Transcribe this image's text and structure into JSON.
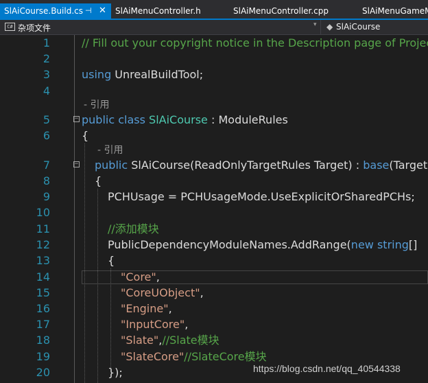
{
  "tabs": [
    {
      "label": "SlAiCourse.Build.cs",
      "active": true
    },
    {
      "label": "SlAiMenuController.h",
      "active": false
    },
    {
      "label": "SlAiMenuController.cpp",
      "active": false
    },
    {
      "label": "SlAiMenuGameM",
      "active": false
    }
  ],
  "tab_pin_glyph": "⊣",
  "tab_close_glyph": "✕",
  "navbar": {
    "project_icon_text": "C#",
    "project_label": "杂项文件",
    "class_label": "SlAiCourse"
  },
  "editor": {
    "refs_label": "引用",
    "lines": [
      {
        "n": "1",
        "tokens": [
          {
            "text": "// Fill out your copyright notice in the Description page of Project",
            "style": "c"
          }
        ]
      },
      {
        "n": "2",
        "tokens": []
      },
      {
        "n": "3",
        "tokens": [
          {
            "text": "using",
            "style": "k"
          },
          {
            "text": " UnrealBuildTool;",
            "style": "p"
          }
        ]
      },
      {
        "n": "4",
        "tokens": []
      },
      {
        "n": "5",
        "tokens": [
          {
            "text": "public",
            "style": "k"
          },
          {
            "text": " ",
            "style": "p"
          },
          {
            "text": "class",
            "style": "k"
          },
          {
            "text": " ",
            "style": "p"
          },
          {
            "text": "SlAiCourse",
            "style": "t"
          },
          {
            "text": " : ModuleRules",
            "style": "p"
          }
        ]
      },
      {
        "n": "6",
        "tokens": [
          {
            "text": "{",
            "style": "p"
          }
        ]
      },
      {
        "n": "7",
        "tokens": [
          {
            "text": "public",
            "style": "k"
          },
          {
            "text": " SlAiCourse(ReadOnlyTargetRules Target) : ",
            "style": "p"
          },
          {
            "text": "base",
            "style": "k"
          },
          {
            "text": "(Target)",
            "style": "p"
          }
        ]
      },
      {
        "n": "8",
        "tokens": [
          {
            "text": "{",
            "style": "p"
          }
        ]
      },
      {
        "n": "9",
        "tokens": [
          {
            "text": "PCHUsage = PCHUsageMode.UseExplicitOrSharedPCHs;",
            "style": "p"
          }
        ]
      },
      {
        "n": "10",
        "tokens": []
      },
      {
        "n": "11",
        "tokens": [
          {
            "text": "//添加模块",
            "style": "c"
          }
        ]
      },
      {
        "n": "12",
        "tokens": [
          {
            "text": "PublicDependencyModuleNames.AddRange(",
            "style": "p"
          },
          {
            "text": "new",
            "style": "k"
          },
          {
            "text": " ",
            "style": "p"
          },
          {
            "text": "string",
            "style": "k"
          },
          {
            "text": "[]",
            "style": "p"
          }
        ]
      },
      {
        "n": "13",
        "tokens": [
          {
            "text": "{",
            "style": "p"
          }
        ]
      },
      {
        "n": "14",
        "tokens": [
          {
            "text": "\"Core\"",
            "style": "s"
          },
          {
            "text": ",",
            "style": "p"
          }
        ]
      },
      {
        "n": "15",
        "tokens": [
          {
            "text": "\"CoreUObject\"",
            "style": "s"
          },
          {
            "text": ",",
            "style": "p"
          }
        ]
      },
      {
        "n": "16",
        "tokens": [
          {
            "text": "\"Engine\"",
            "style": "s"
          },
          {
            "text": ",",
            "style": "p"
          }
        ]
      },
      {
        "n": "17",
        "tokens": [
          {
            "text": "\"InputCore\"",
            "style": "s"
          },
          {
            "text": ",",
            "style": "p"
          }
        ]
      },
      {
        "n": "18",
        "tokens": [
          {
            "text": "\"Slate\"",
            "style": "s"
          },
          {
            "text": ",",
            "style": "p"
          },
          {
            "text": "//Slate模块",
            "style": "c"
          }
        ]
      },
      {
        "n": "19",
        "tokens": [
          {
            "text": "\"SlateCore\"",
            "style": "s"
          },
          {
            "text": "//SlateCore模块",
            "style": "c"
          }
        ]
      },
      {
        "n": "20",
        "tokens": [
          {
            "text": "});",
            "style": "p"
          }
        ]
      }
    ]
  },
  "watermark": "https://blog.csdn.net/qq_40544338"
}
